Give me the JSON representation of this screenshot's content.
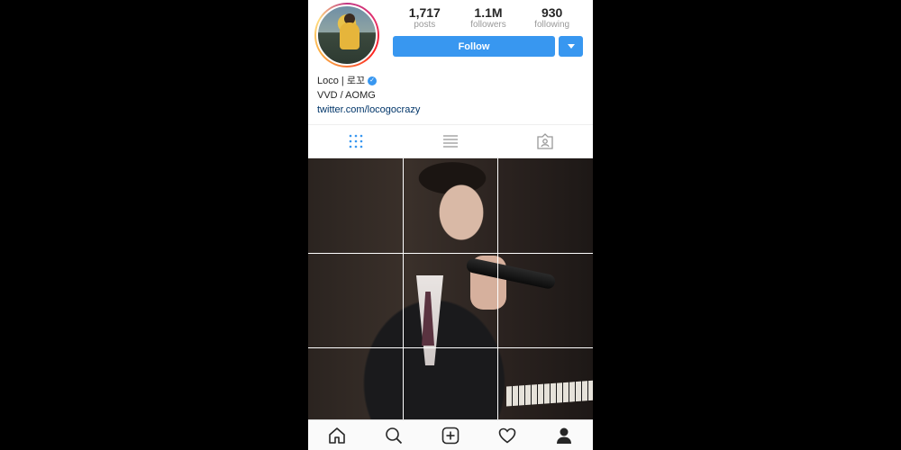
{
  "profile": {
    "stats": [
      {
        "value": "1,717",
        "label": "posts"
      },
      {
        "value": "1.1M",
        "label": "followers"
      },
      {
        "value": "930",
        "label": "following"
      }
    ],
    "follow_label": "Follow",
    "name": "Loco | 로꼬",
    "verified_icon": "verified-badge-icon",
    "bio_line": "VVD / AOMG",
    "link": "twitter.com/locogocrazy"
  },
  "tabs": [
    {
      "icon": "grid-view-icon",
      "active": true
    },
    {
      "icon": "list-view-icon",
      "active": false
    },
    {
      "icon": "tagged-photos-icon",
      "active": false
    }
  ],
  "bottom_nav": [
    {
      "icon": "home-icon"
    },
    {
      "icon": "search-icon"
    },
    {
      "icon": "add-post-icon"
    },
    {
      "icon": "heart-icon"
    },
    {
      "icon": "profile-icon",
      "active": true
    }
  ],
  "colors": {
    "accent": "#3897f0",
    "background": "#000000",
    "tab_active": "#3897f0",
    "icon": "#262626"
  }
}
